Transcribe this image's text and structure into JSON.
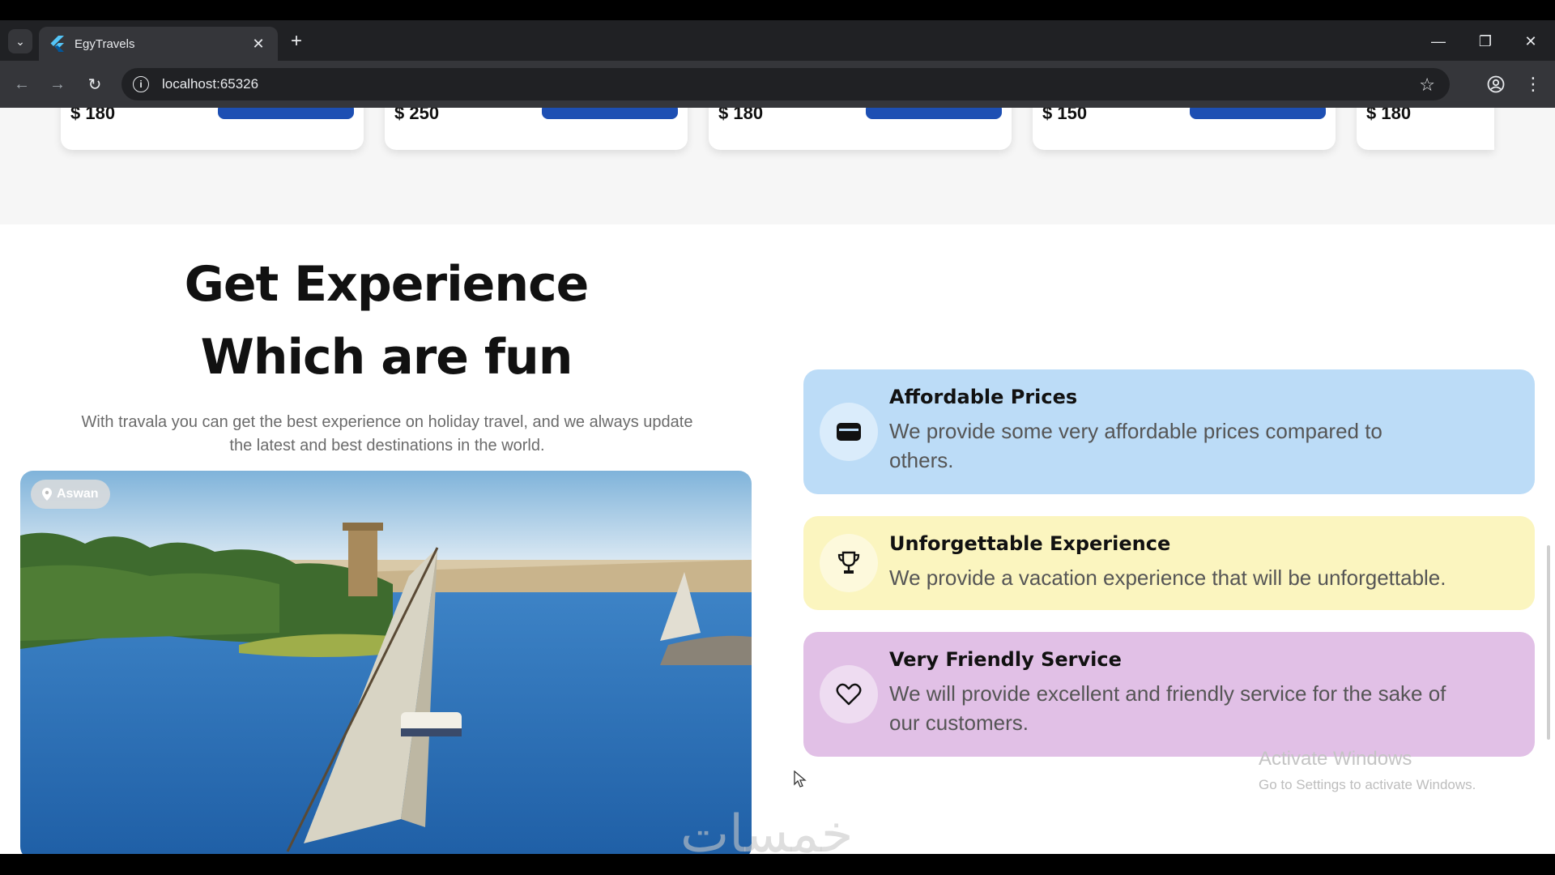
{
  "browser": {
    "tab_title": "EgyTravels",
    "url": "localhost:65326"
  },
  "prev_cards": [
    {
      "price": "$ 180"
    },
    {
      "price": "$ 250"
    },
    {
      "price": "$ 180"
    },
    {
      "price": "$ 150"
    },
    {
      "price": "$ 180"
    }
  ],
  "experience": {
    "headline_line1": "Get Experience",
    "headline_line2": "Which are fun",
    "subtext_line1": "With travala you can get the best experience on holiday travel, and we always update",
    "subtext_line2": "the latest and best destinations in the world.",
    "location_badge": "Aswan"
  },
  "features": [
    {
      "title": "Affordable Prices",
      "desc_line1": "We provide some very affordable prices compared to",
      "desc_line2": "others.",
      "color": "#bcdcf7",
      "icon": "wallet-icon"
    },
    {
      "title": "Unforgettable Experience",
      "desc_line1": "We provide a vacation experience that will be unforgettable.",
      "desc_line2": "",
      "color": "#fbf5bf",
      "icon": "trophy-icon"
    },
    {
      "title": "Very Friendly Service",
      "desc_line1": "We will provide excellent and friendly service for the sake of",
      "desc_line2": "our customers.",
      "color": "#e1c0e6",
      "icon": "heart-icon"
    }
  ],
  "os_watermark": {
    "line1": "Activate Windows",
    "line2": "Go to Settings to activate Windows."
  },
  "site_watermark": "خمسات"
}
